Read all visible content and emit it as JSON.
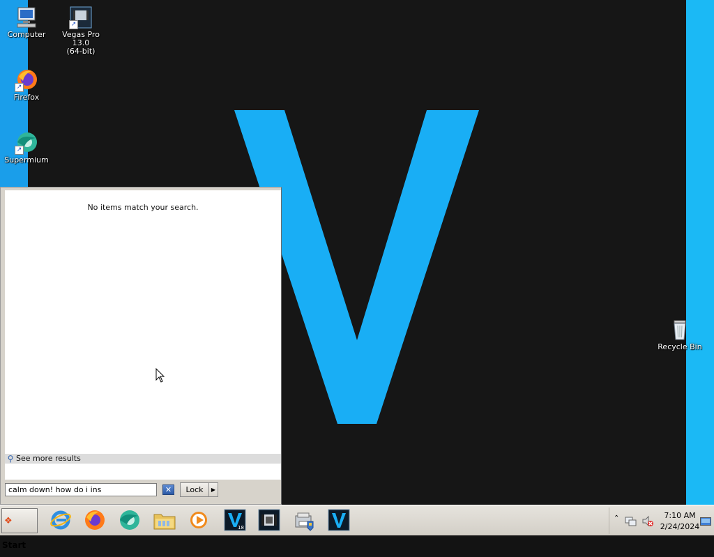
{
  "desktop": {
    "icons": [
      {
        "id": "computer",
        "label": "Computer"
      },
      {
        "id": "vegas",
        "label_line1": "Vegas Pro 13.0",
        "label_line2": "(64-bit)"
      },
      {
        "id": "firefox",
        "label": "Firefox"
      },
      {
        "id": "supermium",
        "label": "Supermium"
      },
      {
        "id": "recycle",
        "label": "Recycle Bin"
      }
    ],
    "wallpaper": {
      "accent": "#19aef5",
      "background": "#161616",
      "letter": "V"
    }
  },
  "start_menu": {
    "no_results_text": "No items match your search.",
    "see_more_label": "See more results",
    "search": {
      "value": "calm down! how do i ins",
      "clear_glyph": "✕"
    },
    "lock_label": "Lock",
    "lock_arrow_glyph": "▶"
  },
  "taskbar": {
    "start_label": "Start",
    "apps": [
      {
        "name": "internet-explorer"
      },
      {
        "name": "firefox"
      },
      {
        "name": "supermium"
      },
      {
        "name": "file-explorer"
      },
      {
        "name": "media-player"
      },
      {
        "name": "vegas-18"
      },
      {
        "name": "vegas-13"
      },
      {
        "name": "control-panel"
      },
      {
        "name": "vegas"
      }
    ],
    "vegas18_badge": "18",
    "tray": {
      "chevron": "⌃",
      "time": "7:10 AM",
      "date": "2/24/2024"
    }
  }
}
